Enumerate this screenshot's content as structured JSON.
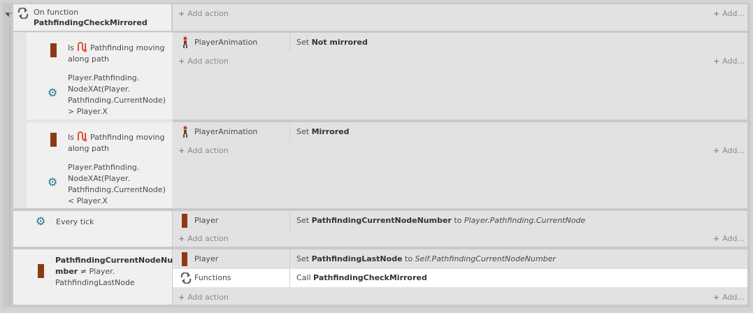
{
  "header": {
    "title_line1": "On function",
    "title_line2": "PathfindingCheckMirrored",
    "add_action": "Add action",
    "add_other": "Add..."
  },
  "events": [
    {
      "cond1_prefix": "Is",
      "cond1_text": "Pathfinding moving along path",
      "cond2_text": "Player.Pathfinding. NodeXAt(Player. Pathfinding.CurrentNode) > Player.X",
      "action_object": "PlayerAnimation",
      "action_verb": "Set",
      "action_value": "Not mirrored",
      "add_action": "Add action",
      "add_other": "Add..."
    },
    {
      "cond1_prefix": "Is",
      "cond1_text": "Pathfinding moving along path",
      "cond2_text": "Player.Pathfinding. NodeXAt(Player. Pathfinding.CurrentNode) < Player.X",
      "action_object": "PlayerAnimation",
      "action_verb": "Set",
      "action_value": "Mirrored",
      "add_action": "Add action",
      "add_other": "Add..."
    }
  ],
  "every_tick": {
    "label": "Every tick",
    "action_object": "Player",
    "action_verb": "Set",
    "action_var": "PathfindingCurrentNodeNumber",
    "action_to": "to",
    "action_expr": "Player.Pathfinding.CurrentNode",
    "add_action": "Add action",
    "add_other": "Add..."
  },
  "compare_event": {
    "cond_line1": "PathfindingCurrentNodeNu",
    "cond_line2_bold": "mber",
    "cond_line2_rest": "≠ Player.",
    "cond_line3": "PathfindingLastNode",
    "action1_object": "Player",
    "action1_verb": "Set",
    "action1_var": "PathfindingLastNode",
    "action1_to": "to",
    "action1_expr": "Self.PathfindingCurrentNodeNumber",
    "action2_object": "Functions",
    "action2_verb": "Call",
    "action2_func": "PathfindingCheckMirrored",
    "add_action": "Add action",
    "add_other": "Add..."
  },
  "colors": {
    "link": "#1f6fb5",
    "object_bar": "#8b3a14",
    "gear": "#1b7d91",
    "pathfinding_icon": "#e0503c"
  },
  "icons": [
    "collapse-triangle-icon",
    "function-loop-icon",
    "sprite-object-icon",
    "pathfinding-icon",
    "system-gear-icon",
    "player-animation-icon",
    "functions-icon"
  ]
}
